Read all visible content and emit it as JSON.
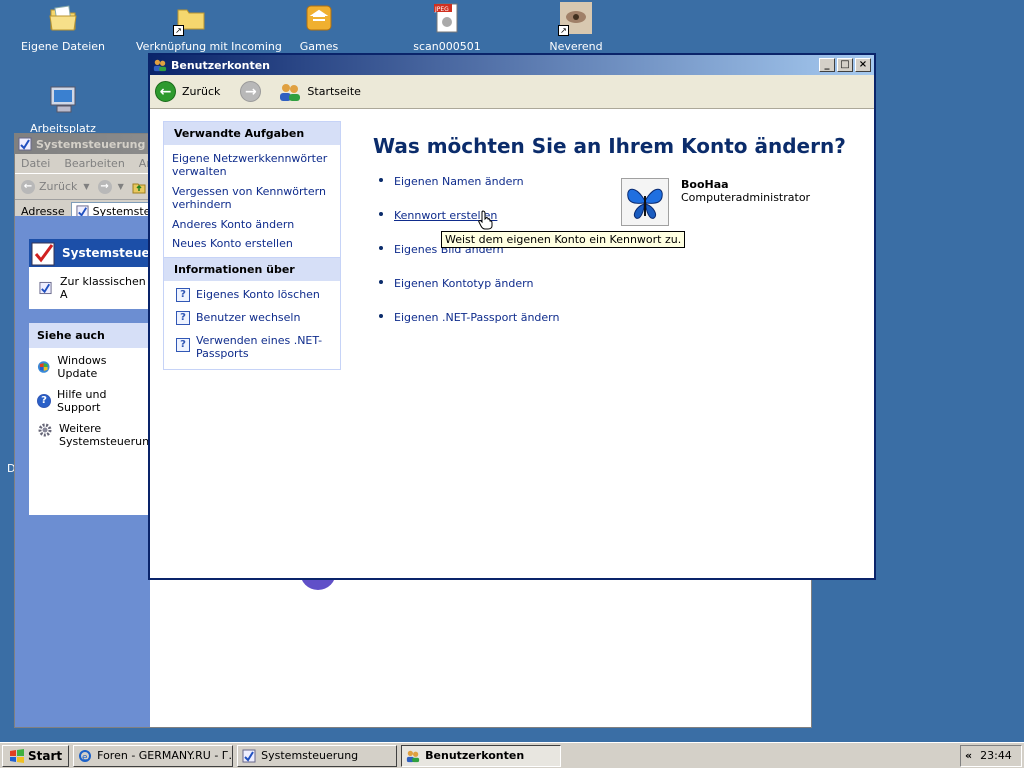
{
  "desktop": {
    "icons": [
      {
        "label": "Eigene Dateien",
        "icon": "my-documents-icon"
      },
      {
        "label": "Verknüpfung mit Incoming",
        "icon": "folder-shortcut-icon"
      },
      {
        "label": "Games",
        "icon": "games-folder-icon"
      },
      {
        "label": "scan000501",
        "icon": "jpeg-file-icon"
      },
      {
        "label": "Neverend",
        "icon": "image-shortcut-icon"
      },
      {
        "label": "Arbeitsplatz",
        "icon": "my-computer-icon"
      }
    ],
    "stray_letter": "D"
  },
  "sys_window": {
    "title": "Systemsteuerung",
    "menu": [
      "Datei",
      "Bearbeiten",
      "An"
    ],
    "back_label": "Zurück",
    "address_label": "Adresse",
    "address_value": "Systemsteue",
    "panel_title": "Systemsteueru",
    "classic_view": "Zur klassischen A",
    "see_also_title": "Siehe auch",
    "see_also": [
      "Windows Update",
      "Hilfe und Support",
      "Weitere Systemsteuerung"
    ]
  },
  "bk_window": {
    "title": "Benutzerkonten",
    "back_label": "Zurück",
    "home_label": "Startseite",
    "related_tasks": {
      "header": "Verwandte Aufgaben",
      "items": [
        "Eigene Netzwerkkennwörter verwalten",
        "Vergessen von Kennwörtern verhindern",
        "Anderes Konto ändern",
        "Neues Konto erstellen"
      ]
    },
    "info": {
      "header": "Informationen über",
      "items": [
        "Eigenes Konto löschen",
        "Benutzer wechseln",
        "Verwenden eines .NET-Passports"
      ]
    },
    "heading": "Was möchten Sie an Ihrem Konto ändern?",
    "actions": [
      "Eigenen Namen ändern",
      "Kennwort erstellen",
      "Eigenes Bild ändern",
      "Eigenen Kontotyp ändern",
      "Eigenen .NET-Passport ändern"
    ],
    "tooltip": "Weist dem eigenen Konto ein Kennwort zu.",
    "account": {
      "name": "BooHaa",
      "type": "Computeradministrator"
    }
  },
  "taskbar": {
    "start": "Start",
    "tasks": [
      "Foren - GERMANY.RU - Г...",
      "Systemsteuerung",
      "Benutzerkonten"
    ],
    "tray_chevron": "«",
    "clock": "23:44"
  },
  "colors": {
    "desktop": "#3a6ea5",
    "title_active": "#0a246a",
    "link": "#0f2c8c",
    "heading": "#0b2c6b"
  }
}
